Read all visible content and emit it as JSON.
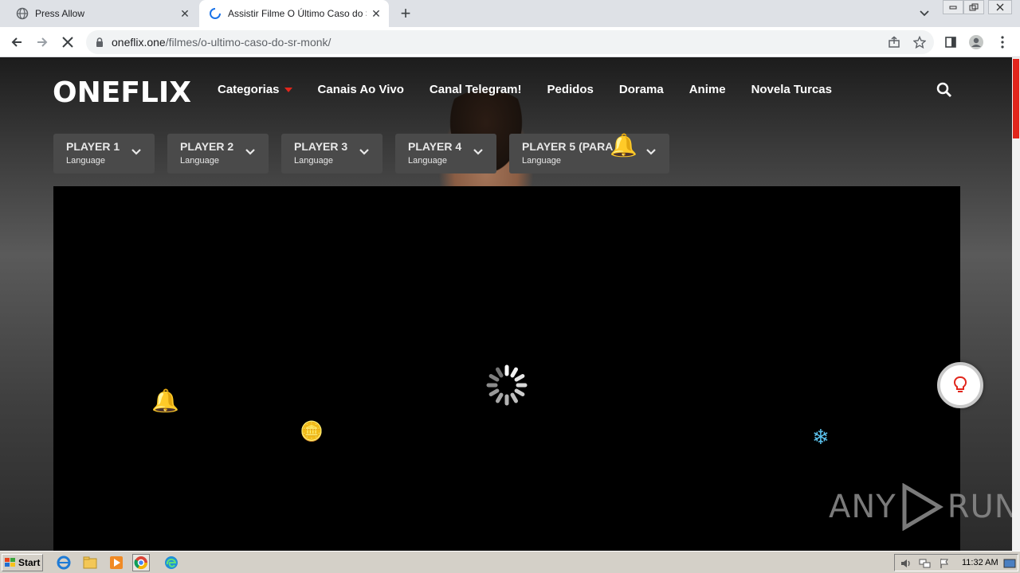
{
  "browser": {
    "tabs": [
      {
        "title": "Press Allow",
        "active": false
      },
      {
        "title": "Assistir Filme O Último Caso do Sr. M",
        "active": true
      }
    ],
    "url_host": "oneflix.one",
    "url_path": "/filmes/o-ultimo-caso-do-sr-monk/"
  },
  "site": {
    "logo": "ONEFLIX",
    "nav": [
      "Categorias",
      "Canais Ao Vivo",
      "Canal Telegram!",
      "Pedidos",
      "Dorama",
      "Anime",
      "Novela Turcas"
    ],
    "players": [
      {
        "label": "PLAYER 1",
        "lang": "Language"
      },
      {
        "label": "PLAYER 2",
        "lang": "Language"
      },
      {
        "label": "PLAYER 3",
        "lang": "Language"
      },
      {
        "label": "PLAYER 4",
        "lang": "Language"
      },
      {
        "label": "PLAYER 5 (PARA",
        "lang": "Language"
      }
    ],
    "decorations": [
      "🔔",
      "🔔",
      "🪙",
      "❄"
    ],
    "watermark_left": "ANY",
    "watermark_right": "RUN"
  },
  "taskbar": {
    "start_label": "Start",
    "clock": "11:32 AM"
  },
  "colors": {
    "accent": "#e1261c",
    "tab_strip": "#dee1e6",
    "taskbar": "#d4d0c8"
  }
}
